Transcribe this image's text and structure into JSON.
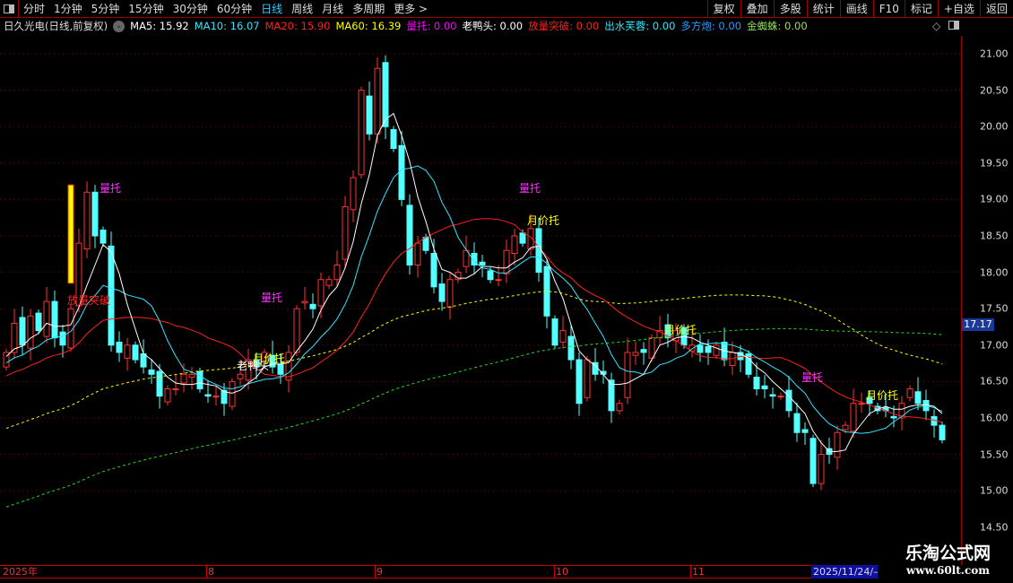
{
  "topbar": {
    "periods": [
      "分时",
      "1分钟",
      "5分钟",
      "15分钟",
      "30分钟",
      "60分钟",
      "日线",
      "周线",
      "月线",
      "多周期",
      "更多 >"
    ],
    "active": "日线",
    "tools": [
      "复权",
      "叠加",
      "多股",
      "统计",
      "画线",
      "F10",
      "标记",
      "+自选",
      "返回"
    ]
  },
  "legend": {
    "title": "日久光电(日线,前复权)",
    "items": [
      {
        "text": "MA5: 15.92",
        "color": "#ffffff"
      },
      {
        "text": "MA10: 16.07",
        "color": "#33e6ff"
      },
      {
        "text": "MA20: 15.90",
        "color": "#ff2020"
      },
      {
        "text": "MA60: 16.39",
        "color": "#ffff00"
      },
      {
        "text": "量托: 0.00",
        "color": "#ff00ff"
      },
      {
        "text": "老鸭头: 0.00",
        "color": "#ffffff"
      },
      {
        "text": "放量突破: 0.00",
        "color": "#ff2020"
      },
      {
        "text": "出水芙蓉: 0.00",
        "color": "#33e6ff"
      },
      {
        "text": "多方炮: 0.00",
        "color": "#2a9cff"
      },
      {
        "text": "金蜘蛛: 0.00",
        "color": "#99dd66"
      }
    ]
  },
  "price_axis": [
    "21.00",
    "20.50",
    "20.00",
    "19.50",
    "19.00",
    "18.50",
    "18.00",
    "17.50",
    "17.00",
    "16.50",
    "16.00",
    "15.50",
    "15.00",
    "14.50"
  ],
  "current_price": "17.17",
  "time_axis": [
    {
      "label": "2025年"
    },
    {
      "label": "8"
    },
    {
      "label": "9"
    },
    {
      "label": "10"
    },
    {
      "label": "11"
    }
  ],
  "date_box": "2025/11/24/—",
  "watermark": {
    "name": "乐淘公式网",
    "url": "www.60lt.com"
  },
  "signals": [
    {
      "text": "量托",
      "color": "#ff33ff",
      "bar": 12
    },
    {
      "text": "放量突破",
      "color": "#ff2020",
      "bar": 8
    },
    {
      "text": "量托",
      "color": "#ff33ff",
      "bar": 32
    },
    {
      "text": "老鸭头",
      "color": "#ffffff",
      "bar": 29
    },
    {
      "text": "月价托",
      "color": "#ffff00",
      "bar": 31
    },
    {
      "text": "量托",
      "color": "#ff33ff",
      "bar": 64
    },
    {
      "text": "月价托",
      "color": "#ffff00",
      "bar": 65
    },
    {
      "text": "月价托",
      "color": "#ffff00",
      "bar": 82
    },
    {
      "text": "量托",
      "color": "#ff33ff",
      "bar": 99
    },
    {
      "text": "月价托",
      "color": "#ffff00",
      "bar": 107
    }
  ],
  "chart_data": {
    "type": "candlestick",
    "ylim": [
      14.5,
      21.0
    ],
    "close": [
      16.9,
      17.3,
      17.0,
      17.4,
      17.2,
      17.6,
      17.1,
      17.0,
      17.5,
      18.4,
      19.1,
      18.5,
      18.4,
      17.0,
      16.9,
      17.0,
      16.8,
      16.7,
      16.6,
      16.3,
      16.4,
      16.4,
      16.6,
      16.6,
      16.4,
      16.3,
      16.3,
      16.2,
      16.5,
      16.6,
      16.8,
      16.7,
      16.9,
      16.7,
      16.6,
      16.9,
      17.5,
      17.6,
      17.5,
      17.9,
      17.9,
      18.1,
      18.9,
      19.3,
      20.5,
      19.9,
      20.8,
      20.0,
      19.7,
      19.0,
      18.1,
      18.4,
      18.3,
      17.8,
      17.6,
      17.9,
      18.0,
      18.3,
      18.1,
      18.1,
      17.9,
      17.9,
      18.3,
      18.5,
      18.4,
      18.6,
      18.0,
      17.4,
      17.0,
      17.2,
      16.8,
      16.2,
      16.8,
      16.6,
      16.6,
      16.1,
      16.2,
      16.9,
      16.9,
      16.9,
      17.1,
      17.2,
      17.1,
      17.2,
      17.0,
      17.0,
      16.9,
      16.9,
      17.0,
      16.8,
      16.9,
      16.8,
      16.6,
      16.4,
      16.4,
      16.3,
      16.3,
      16.1,
      15.8,
      15.8,
      15.1,
      15.5,
      15.5,
      15.8,
      15.9,
      16.2,
      16.2,
      16.2,
      16.1,
      16.1,
      16.0,
      16.2,
      16.4,
      16.2,
      16.1,
      15.9,
      15.7
    ]
  },
  "colors": {
    "up": "#ff3232",
    "down": "#54ffff",
    "ma5": "#ffffff",
    "ma10": "#33e6ff",
    "ma20": "#ff2020",
    "ma60": "#ffff00",
    "ma120": "#22dd22",
    "grid": "#7a0000"
  }
}
